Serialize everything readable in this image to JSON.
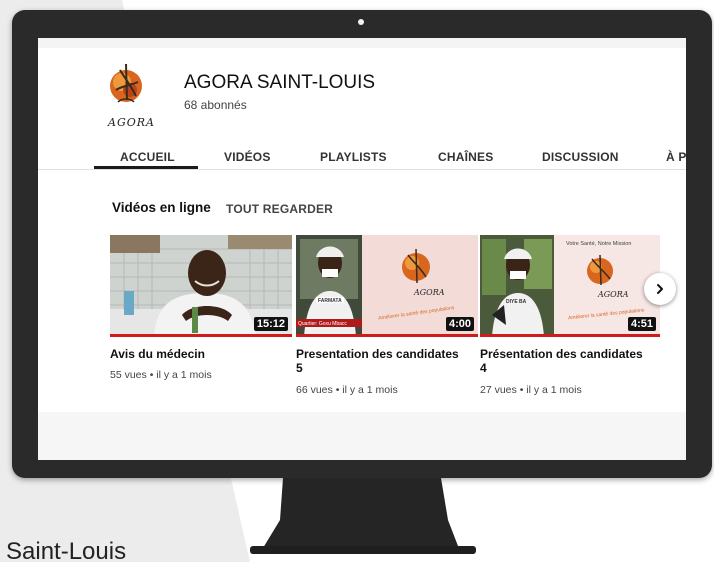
{
  "channel": {
    "name": "AGORA SAINT-LOUIS",
    "subscribers": "68 abonnés",
    "logo_text": "AGORA"
  },
  "tabs": [
    "ACCUEIL",
    "VIDÉOS",
    "PLAYLISTS",
    "CHAÎNES",
    "DISCUSSION",
    "À P"
  ],
  "section": {
    "title": "Vidéos en ligne",
    "action": "TOUT REGARDER"
  },
  "videos": [
    {
      "title_lines": [
        "Avis du médecin"
      ],
      "meta": "55 vues • il y a 1 mois",
      "duration": "15:12"
    },
    {
      "title_lines": [
        "Presentation des candidates",
        "5"
      ],
      "meta": "66 vues • il y a 1 mois",
      "duration": "4:00",
      "overlay_label": "FARMATA",
      "overlay_caption": "Quartier: Goxu Mbacc",
      "banner_text": "AGORA",
      "banner_slogan": "Améliorer la santé des populations"
    },
    {
      "title_lines": [
        "Présentation des candidates",
        "4"
      ],
      "meta": "27 vues • il y a 1 mois",
      "duration": "4:51",
      "overlay_label": "DIYE BA",
      "banner_top": "Votre Santé, Notre Mission",
      "banner_text": "AGORA",
      "banner_slogan": "Améliorer la santé des populations"
    }
  ],
  "caption": "Saint-Louis",
  "colors": {
    "accent": "#d01b1b",
    "frame": "#2a2a2a"
  },
  "icons": {
    "next": "chevron-right-icon"
  }
}
